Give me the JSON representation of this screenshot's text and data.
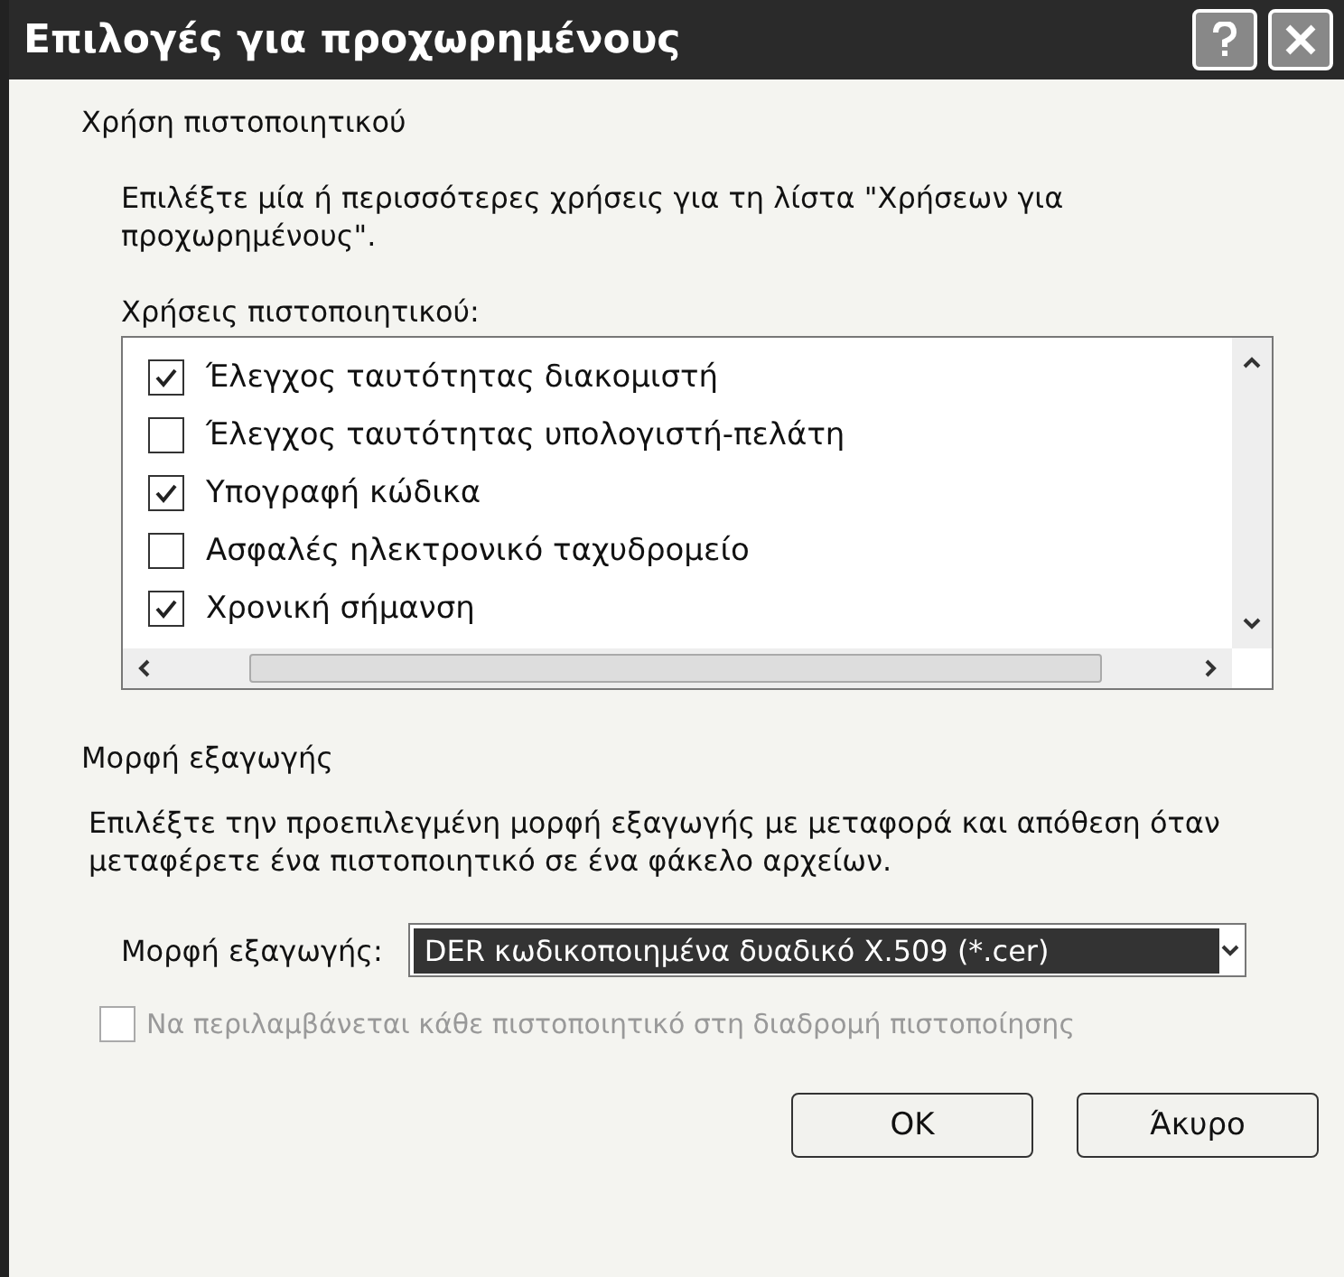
{
  "window": {
    "title": "Επιλογές για προχωρημένους"
  },
  "usage_section": {
    "heading": "Χρήση πιστοποιητικού",
    "description": "Επιλέξτε μία ή περισσότερες χρήσεις για τη λίστα \"Χρήσεων για προχωρημένους\".",
    "list_label": "Χρήσεις πιστοποιητικού:",
    "items": [
      {
        "label": "Έλεγχος ταυτότητας διακομιστή",
        "checked": true
      },
      {
        "label": "Έλεγχος ταυτότητας υπολογιστή-πελάτη",
        "checked": false
      },
      {
        "label": "Υπογραφή κώδικα",
        "checked": true
      },
      {
        "label": "Ασφαλές ηλεκτρονικό ταχυδρομείο",
        "checked": false
      },
      {
        "label": "Χρονική σήμανση",
        "checked": true
      }
    ]
  },
  "export_section": {
    "heading": "Μορφή εξαγωγής",
    "description": "Επιλέξτε την προεπιλεγμένη μορφή εξαγωγής με μεταφορά και απόθεση όταν μεταφέρετε ένα πιστοποιητικό σε ένα φάκελο αρχείων.",
    "format_label": "Μορφή εξαγωγής:",
    "format_value": "DER κωδικοποιημένα δυαδικό X.509 (*.cer)",
    "include_chain": {
      "label": "Να περιλαμβάνεται κάθε πιστοποιητικό στη διαδρομή πιστοποίησης",
      "checked": false,
      "disabled": true
    }
  },
  "buttons": [
    "OK",
    "Άκυρο"
  ]
}
